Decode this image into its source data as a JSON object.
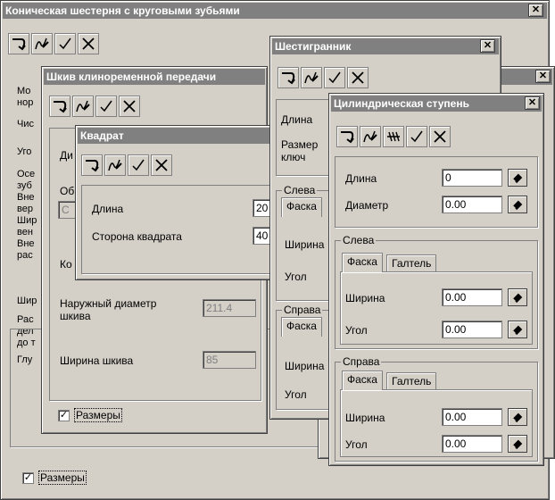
{
  "w_cone": {
    "title": "Коническая шестерня с круговыми зубьями",
    "close_glyph": "✕",
    "left_labels": [
      "Мо",
      "нор",
      "Чис",
      "Уго",
      "Осе",
      "зуб",
      "Вне",
      "вер",
      "Шир",
      "вен",
      "Вне",
      "рас",
      "Шир",
      "Рас",
      "дел",
      "до т",
      "Глу"
    ],
    "checkbox_mark": "✓",
    "checkbox_label": "Размеры"
  },
  "w_pulley": {
    "title": "Шкив клиноременной передачи",
    "left_labels": [
      "Ди",
      "Об",
      "С",
      "Ко"
    ],
    "outer_diameter_label": "Наружный диаметр шкива",
    "outer_diameter_value": "211.4",
    "width_label": "Ширина шкива",
    "width_value": "85",
    "checkbox_mark": "✓",
    "checkbox_label": "Размеры"
  },
  "w_square": {
    "title": "Квадрат",
    "length_label": "Длина",
    "length_value": "20",
    "side_label": "Сторона квадрата",
    "side_value": "40"
  },
  "w_hex": {
    "title": "Шестигранник",
    "close_glyph": "✕",
    "length_label": "Длина",
    "key_label": "Размер ключ",
    "left_group": "Слева",
    "chamfer_tab": "Фаска",
    "width_label": "Ширина",
    "angle_label": "Угол",
    "right_group": "Справа",
    "chamfer_tab2": "Фаска",
    "width_label2": "Ширина",
    "angle_label2": "Угол"
  },
  "w_back": {
    "close_glyph": "✕"
  },
  "w_cyl": {
    "title": "Цилиндрическая ступень",
    "close_glyph": "✕",
    "length_label": "Длина",
    "length_value": "0",
    "diameter_label": "Диаметр",
    "diameter_value": "0.00",
    "left_group": "Слева",
    "tab_chamfer": "Фаска",
    "tab_fillet": "Галтель",
    "left_width_label": "Ширина",
    "left_width_value": "0.00",
    "left_angle_label": "Угол",
    "left_angle_value": "0.00",
    "right_group": "Справа",
    "tab_chamfer2": "Фаска",
    "tab_fillet2": "Галтель",
    "right_width_label": "Ширина",
    "right_width_value": "0.00",
    "right_angle_label": "Угол",
    "right_angle_value": "0.00"
  }
}
